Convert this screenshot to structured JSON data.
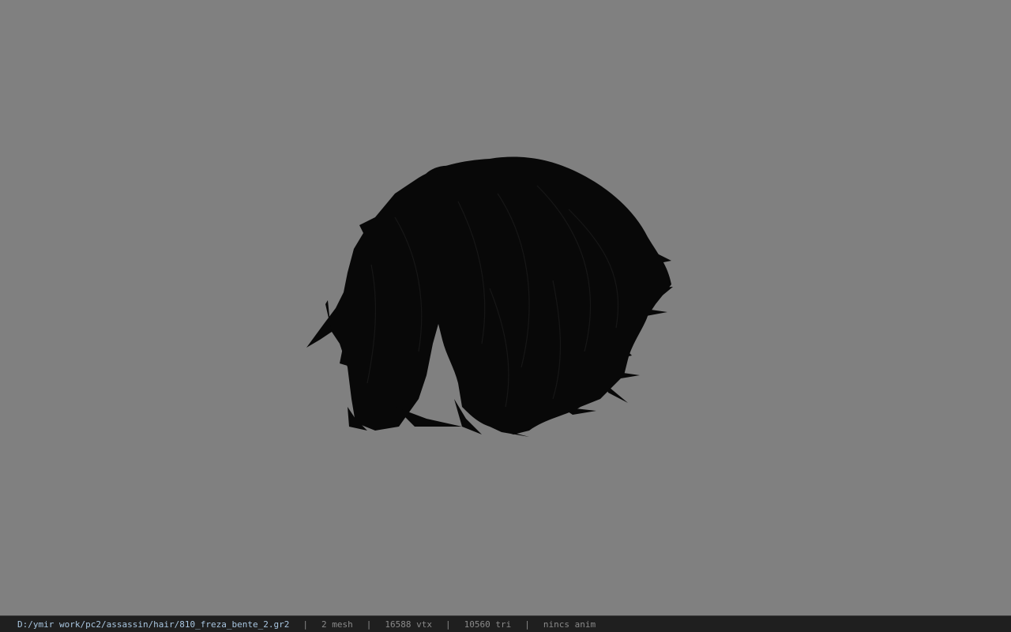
{
  "viewport": {
    "background_color": "#808080",
    "model": {
      "icon": "hair-mesh-render",
      "color": "#0a0a0a"
    }
  },
  "status_bar": {
    "file_path": "D:/ymir work/pc2/assassin/hair/810_freza_bente_2.gr2",
    "separator": "|",
    "mesh_count": "2 mesh",
    "vertex_count": "16588 vtx",
    "triangle_count": "10560 tri",
    "animation": "nincs anim"
  }
}
